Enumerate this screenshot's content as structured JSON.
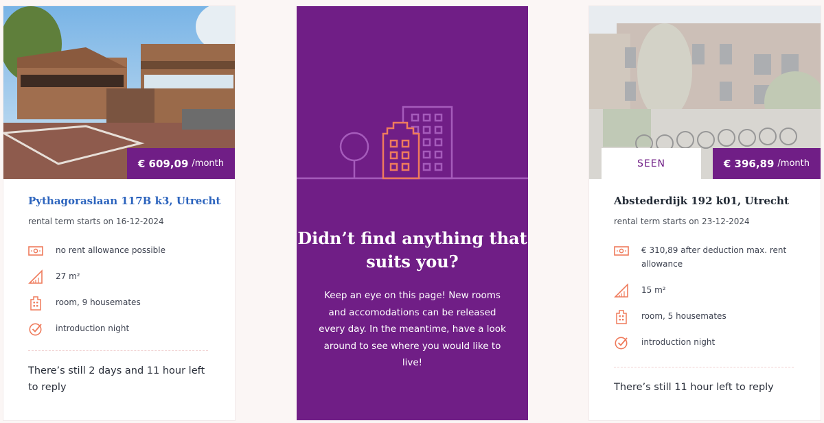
{
  "listings": [
    {
      "price": "€ 609,09",
      "per": "/month",
      "title": "Pythagoraslaan 117B k3, Utrecht",
      "term": "rental term starts on 16-12-2024",
      "features": [
        {
          "icon": "money-icon",
          "text": "no rent allowance possible"
        },
        {
          "icon": "area-icon",
          "text": "27 m²"
        },
        {
          "icon": "building-icon",
          "text": "room, 9 housemates"
        },
        {
          "icon": "check-circle-icon",
          "text": "introduction night"
        }
      ],
      "reply": "There’s still 2 days and 11 hour left to reply"
    },
    {
      "seen_label": "SEEN",
      "price": "€ 396,89",
      "per": "/month",
      "title": "Abstederdijk 192 k01, Utrecht",
      "term": "rental term starts on 23-12-2024",
      "features": [
        {
          "icon": "money-icon",
          "text": "€ 310,89 after deduction max. rent allowance"
        },
        {
          "icon": "area-icon",
          "text": "15 m²"
        },
        {
          "icon": "building-icon",
          "text": "room, 5 housemates"
        },
        {
          "icon": "check-circle-icon",
          "text": "introduction night"
        }
      ],
      "reply": "There’s still 11 hour left to reply"
    }
  ],
  "promo": {
    "heading": "Didn’t find anything that suits you?",
    "body": "Keep an eye on this page! New rooms and accomodations can be released every day. In the meantime, have a look around to see where you would like to live!"
  },
  "colors": {
    "accent": "#701e86",
    "icon": "#ef7b5c",
    "title_link": "#2b63bd"
  }
}
